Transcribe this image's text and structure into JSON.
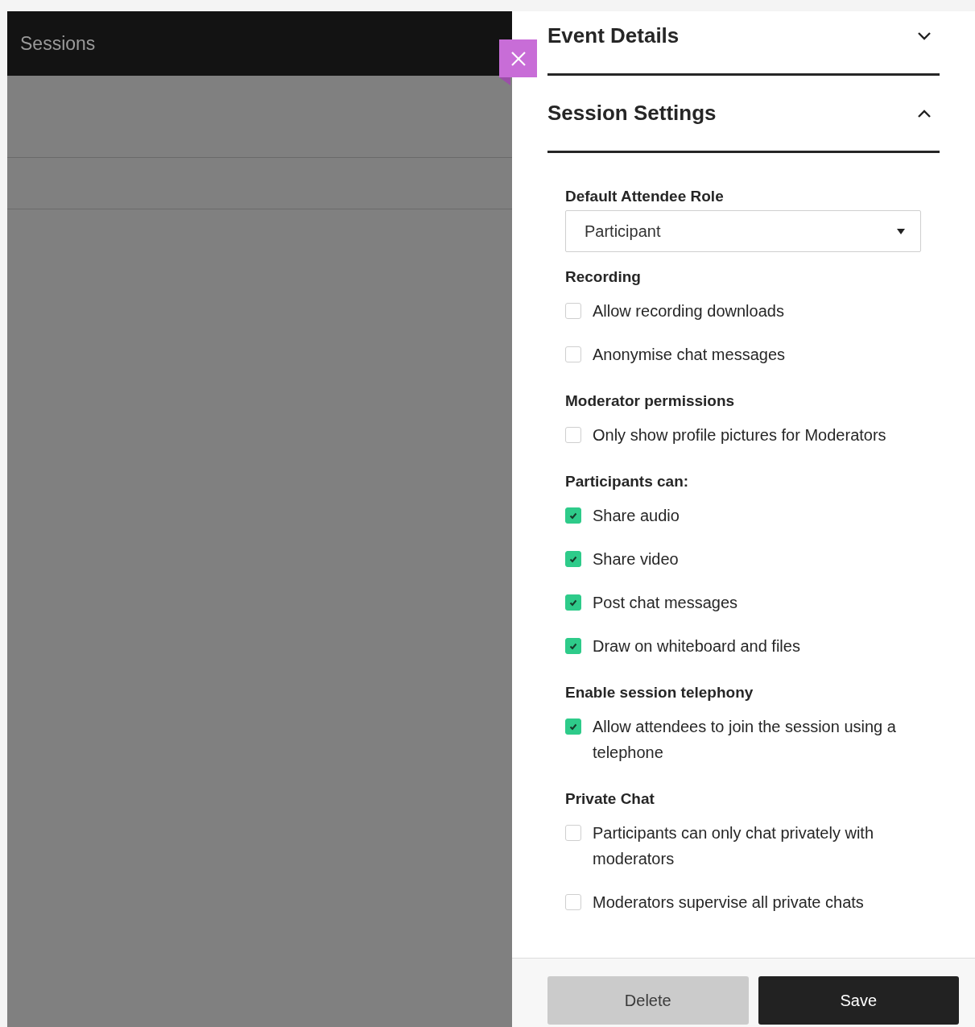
{
  "sidebar": {
    "title": "Sessions"
  },
  "panel": {
    "sections": [
      {
        "title": "Event Details",
        "expanded": false
      },
      {
        "title": "Session Settings",
        "expanded": true
      }
    ],
    "role": {
      "label": "Default Attendee Role",
      "value": "Participant"
    },
    "groups": [
      {
        "title": "Recording",
        "options": [
          {
            "label": "Allow recording downloads",
            "checked": false
          },
          {
            "label": "Anonymise chat messages",
            "checked": false
          }
        ]
      },
      {
        "title": "Moderator permissions",
        "options": [
          {
            "label": "Only show profile pictures for Moderators",
            "checked": false
          }
        ]
      },
      {
        "title": "Participants can:",
        "options": [
          {
            "label": "Share audio",
            "checked": true
          },
          {
            "label": "Share video",
            "checked": true
          },
          {
            "label": "Post chat messages",
            "checked": true
          },
          {
            "label": "Draw on whiteboard and files",
            "checked": true
          }
        ]
      },
      {
        "title": "Enable session telephony",
        "options": [
          {
            "label": "Allow attendees to join the session using a telephone",
            "checked": true
          }
        ]
      },
      {
        "title": "Private Chat",
        "options": [
          {
            "label": "Participants can only chat privately with moderators",
            "checked": false
          },
          {
            "label": "Moderators supervise all private chats",
            "checked": false
          }
        ]
      }
    ],
    "buttons": [
      {
        "label": "Delete",
        "kind": "secondary"
      },
      {
        "label": "Save",
        "kind": "primary"
      }
    ]
  }
}
